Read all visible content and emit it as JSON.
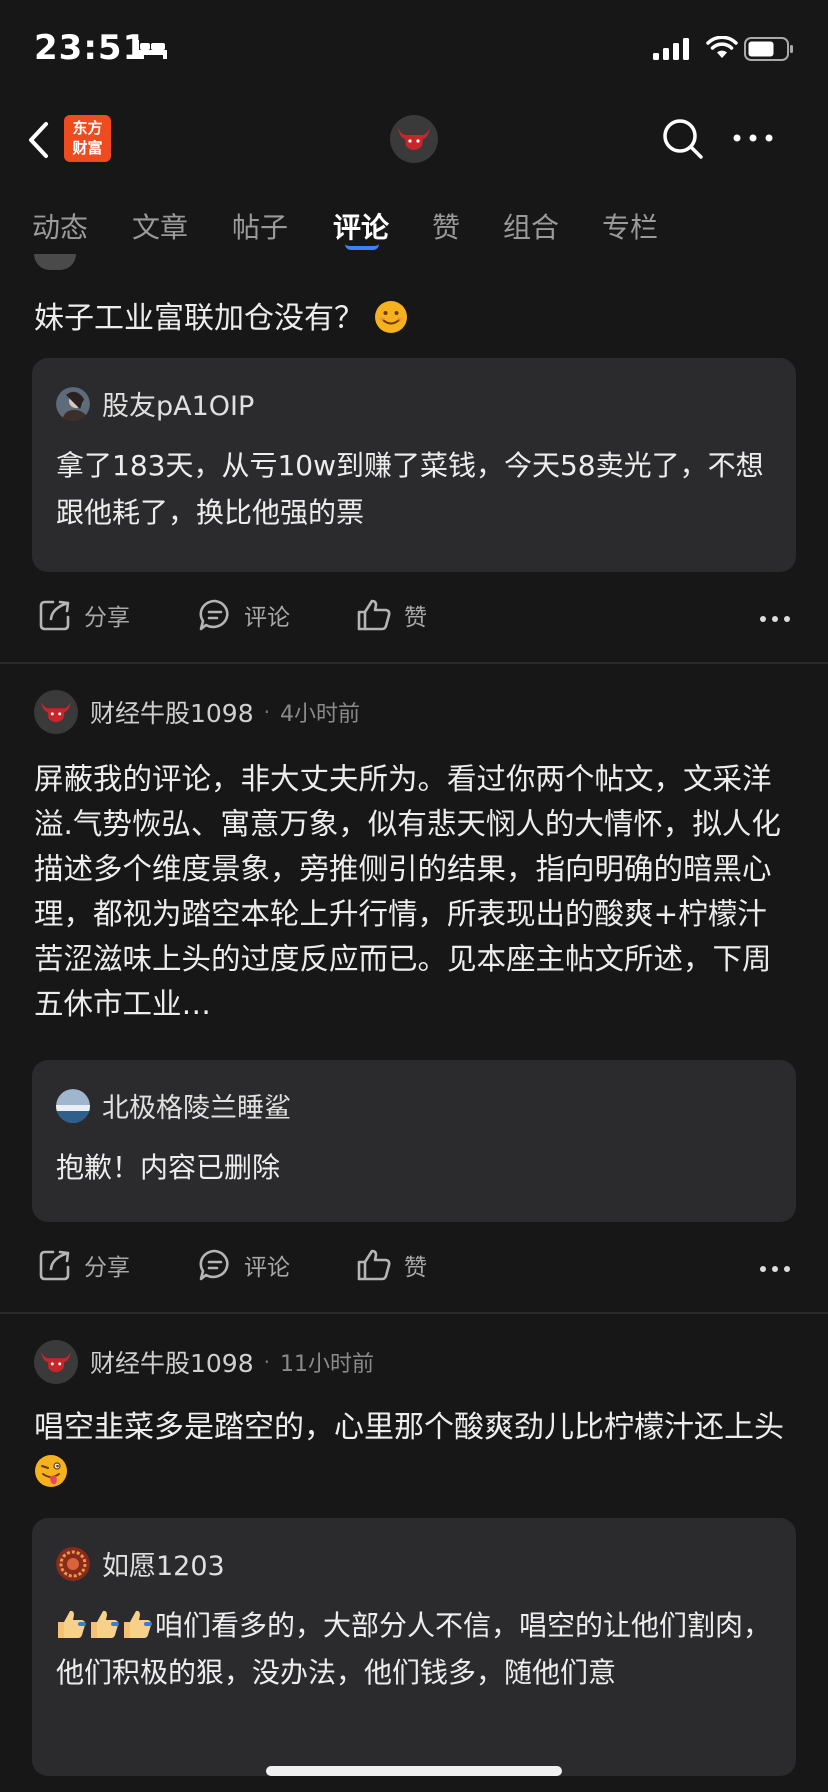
{
  "status_bar": {
    "time": "23:51"
  },
  "nav": {
    "logo_line1": "东方",
    "logo_line2": "财富"
  },
  "tabs": [
    {
      "label": "动态"
    },
    {
      "label": "文章"
    },
    {
      "label": "帖子"
    },
    {
      "label": "评论",
      "active": true
    },
    {
      "label": "赞"
    },
    {
      "label": "组合"
    },
    {
      "label": "专栏"
    }
  ],
  "actions": {
    "share": "分享",
    "comment": "评论",
    "like": "赞"
  },
  "posts": [
    {
      "text": "妹子工业富联加仓没有？",
      "quote": {
        "user": "股友pA1OIP",
        "text": "拿了183天，从亏10w到赚了菜钱，今天58卖光了，不想跟他耗了，换比他强的票"
      }
    },
    {
      "author": "财经牛股1098",
      "dot": "·",
      "time": "4小时前",
      "text": "屏蔽我的评论，非大丈夫所为。看过你两个帖文，文采洋溢.气势恢弘、寓意万象，似有悲天悯人的大情怀，拟人化描述多个维度景象，旁推侧引的结果，指向明确的暗黑心理，都视为踏空本轮上升行情，所表现出的酸爽+柠檬汁苦涩滋味上头的过度反应而已。见本座主帖文所述，下周五休市工业…",
      "quote": {
        "user": "北极格陵兰睡鲨",
        "text": "抱歉！内容已删除"
      }
    },
    {
      "author": "财经牛股1098",
      "dot": "·",
      "time": "11小时前",
      "text": "唱空韭菜多是踏空的，心里那个酸爽劲儿比柠檬汁还上头",
      "quote": {
        "user": "如愿1203",
        "text": "咱们看多的，大部分人不信，唱空的让他们割肉，他们积极的狠，没办法，他们钱多，随他们意"
      }
    }
  ]
}
